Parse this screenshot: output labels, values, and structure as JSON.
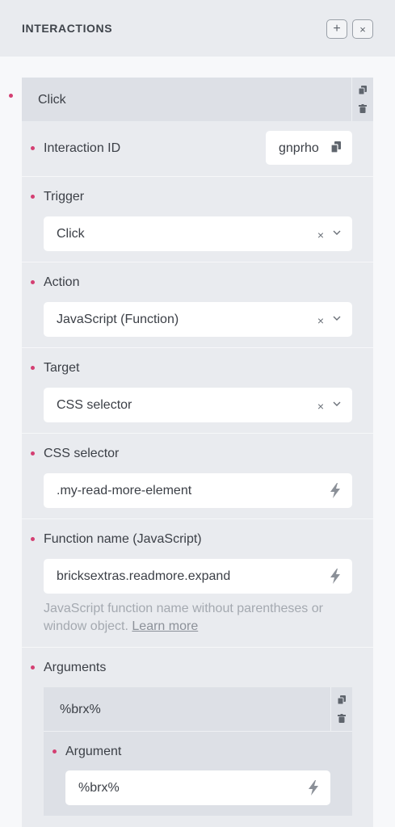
{
  "header": {
    "title": "INTERACTIONS",
    "add_glyph": "+",
    "close_glyph": "×"
  },
  "interaction": {
    "title": "Click",
    "id_label": "Interaction ID",
    "id_value": "gnprho",
    "trigger": {
      "label": "Trigger",
      "value": "Click"
    },
    "action": {
      "label": "Action",
      "value": "JavaScript (Function)"
    },
    "target": {
      "label": "Target",
      "value": "CSS selector"
    },
    "css_selector": {
      "label": "CSS selector",
      "value": ".my-read-more-element"
    },
    "function_name": {
      "label": "Function name (JavaScript)",
      "value": "bricksextras.readmore.expand",
      "help_line1": "JavaScript function name without parentheses or",
      "help_line2": "window object.",
      "help_link": "Learn more"
    },
    "arguments": {
      "label": "Arguments",
      "item_title": "%brx%",
      "argument_label": "Argument",
      "argument_value": "%brx%"
    }
  },
  "glyphs": {
    "clear": "×"
  },
  "colors": {
    "accent_dot": "#d43f72",
    "panel_bg": "#e9ebef",
    "control_bg": "#ffffff"
  }
}
